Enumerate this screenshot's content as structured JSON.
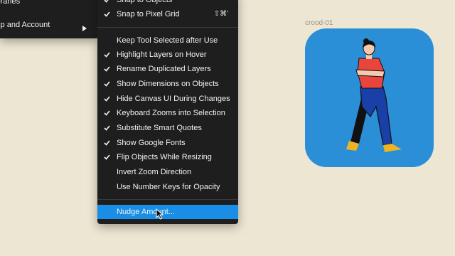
{
  "left_menu": {
    "items": [
      {
        "label": "ibraries"
      },
      {
        "label": "elp and Account"
      }
    ]
  },
  "right_menu": {
    "top_items": [
      {
        "label": "Snap to Objects",
        "checked": true,
        "shortcut": ""
      },
      {
        "label": "Snap to Pixel Grid",
        "checked": true,
        "shortcut": "⇧⌘'"
      }
    ],
    "items": [
      {
        "label": "Keep Tool Selected after Use",
        "checked": false
      },
      {
        "label": "Highlight Layers on Hover",
        "checked": true
      },
      {
        "label": "Rename Duplicated Layers",
        "checked": true
      },
      {
        "label": "Show Dimensions on Objects",
        "checked": true
      },
      {
        "label": "Hide Canvas UI During Changes",
        "checked": true
      },
      {
        "label": "Keyboard Zooms into Selection",
        "checked": true
      },
      {
        "label": "Substitute Smart Quotes",
        "checked": true
      },
      {
        "label": "Show Google Fonts",
        "checked": true
      },
      {
        "label": "Flip Objects While Resizing",
        "checked": true
      },
      {
        "label": "Invert Zoom Direction",
        "checked": false
      },
      {
        "label": "Use Number Keys for Opacity",
        "checked": false
      }
    ],
    "highlighted_item": {
      "label": "Nudge Amount..."
    }
  },
  "canvas": {
    "frame_name": "crood-01",
    "frame_color": "#2b8fd8",
    "background_color": "#ede6d3"
  },
  "colors": {
    "menu_bg": "#1e1e1e",
    "highlight": "#1a8ee6"
  }
}
